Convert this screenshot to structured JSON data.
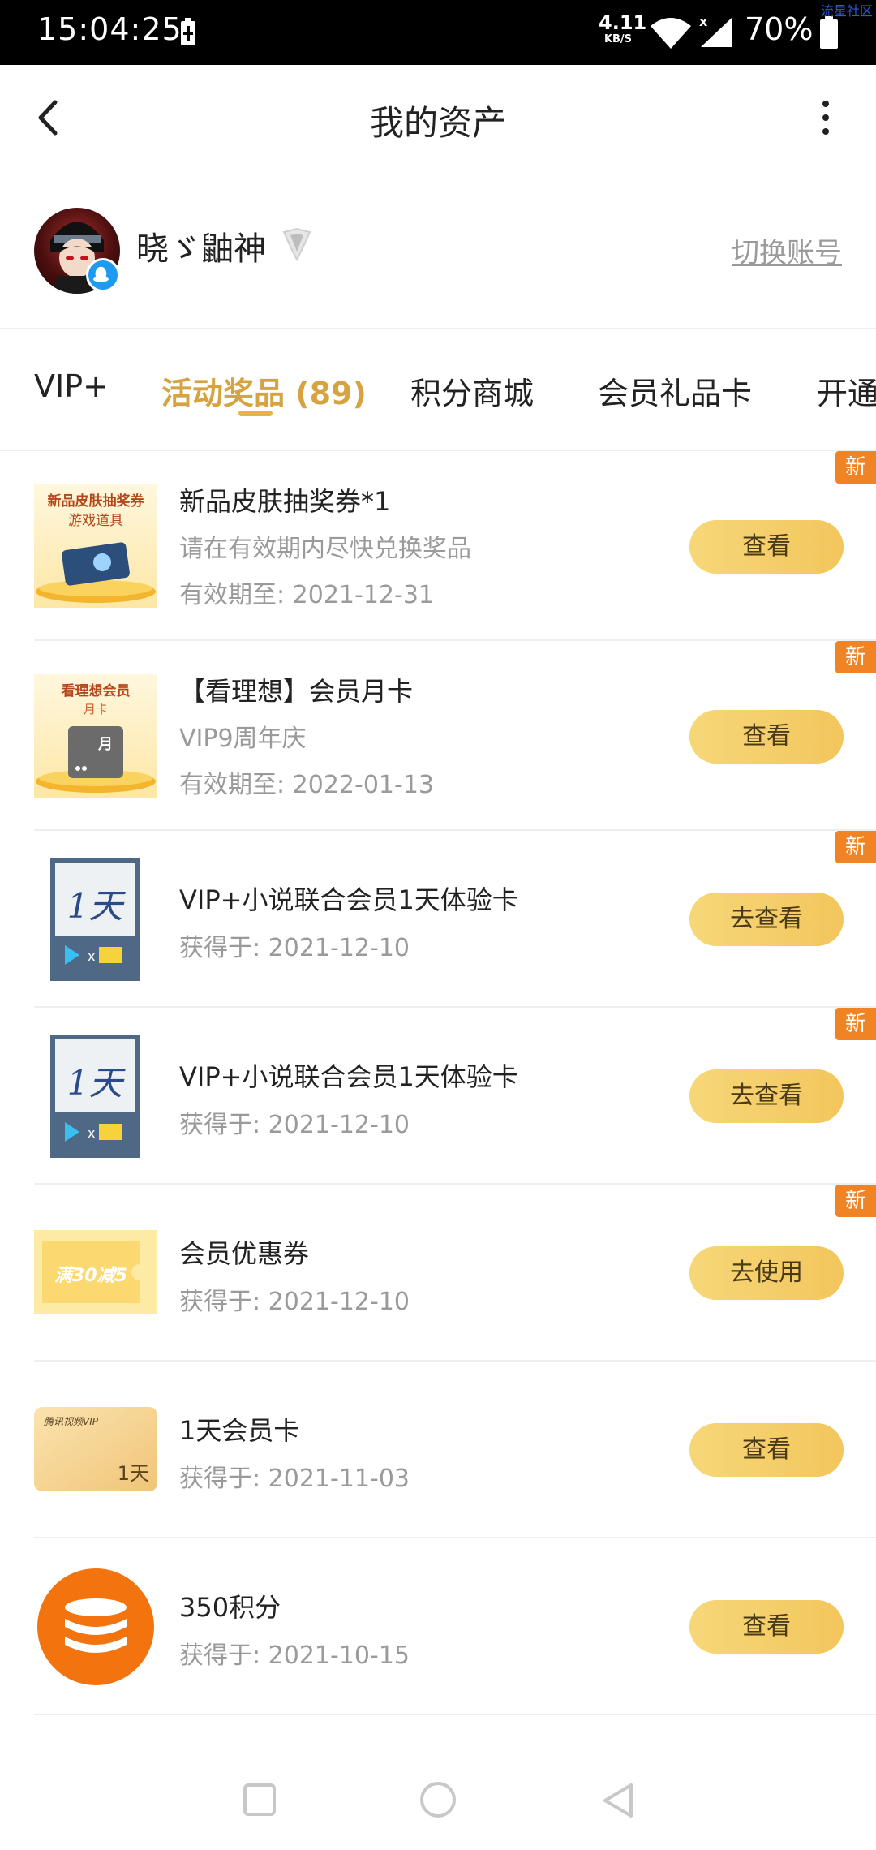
{
  "status_bar": {
    "time": "15:04:25",
    "net_speed_value": "4.11",
    "net_speed_unit": "KB/S",
    "battery_percent": "70%",
    "watermark": "流星社区"
  },
  "header": {
    "title": "我的资产"
  },
  "profile": {
    "username": "晓ゞ鼬神",
    "switch_account": "切换账号"
  },
  "tabs": [
    {
      "label": "VIP+"
    },
    {
      "label": "活动奖品 (89)",
      "active": true
    },
    {
      "label": "积分商城"
    },
    {
      "label": "会员礼品卡"
    },
    {
      "label": "开通"
    }
  ],
  "items": [
    {
      "title": "新品皮肤抽奖券*1",
      "desc": "请在有效期内尽快兑换奖品",
      "date": "有效期至: 2021-12-31",
      "button": "查看",
      "badge": "新",
      "thumb_text_1": "新品皮肤抽奖券",
      "thumb_text_2": "游戏道具",
      "thumb_icon": "lottery-ticket-icon"
    },
    {
      "title": "【看理想】会员月卡",
      "desc": "VIP9周年庆",
      "date": "有效期至: 2022-01-13",
      "button": "查看",
      "badge": "新",
      "thumb_text_1": "看理想会员",
      "thumb_text_2": "月卡",
      "thumb_text_3": "月",
      "thumb_icon": "membership-card-icon"
    },
    {
      "title": "VIP+小说联合会员1天体验卡",
      "date": "获得于: 2021-12-10",
      "button": "去查看",
      "badge": "新",
      "thumb_text_1": "1天",
      "thumb_icon": "trial-card-icon"
    },
    {
      "title": "VIP+小说联合会员1天体验卡",
      "date": "获得于: 2021-12-10",
      "button": "去查看",
      "badge": "新",
      "thumb_text_1": "1天",
      "thumb_icon": "trial-card-icon"
    },
    {
      "title": "会员优惠券",
      "date": "获得于: 2021-12-10",
      "button": "去使用",
      "badge": "新",
      "thumb_text_1": "满30减5",
      "thumb_icon": "coupon-icon"
    },
    {
      "title": "1天会员卡",
      "date": "获得于: 2021-11-03",
      "button": "查看",
      "thumb_text_1": "腾讯视频VIP",
      "thumb_text_2": "1天",
      "thumb_icon": "vip-card-icon"
    },
    {
      "title": "350积分",
      "date": "获得于: 2021-10-15",
      "button": "查看",
      "thumb_icon": "coins-icon"
    }
  ],
  "colors": {
    "accent": "#d7a341",
    "button": "#f5d06a",
    "badge": "#f08323",
    "muted_text": "#9a9a9a"
  }
}
